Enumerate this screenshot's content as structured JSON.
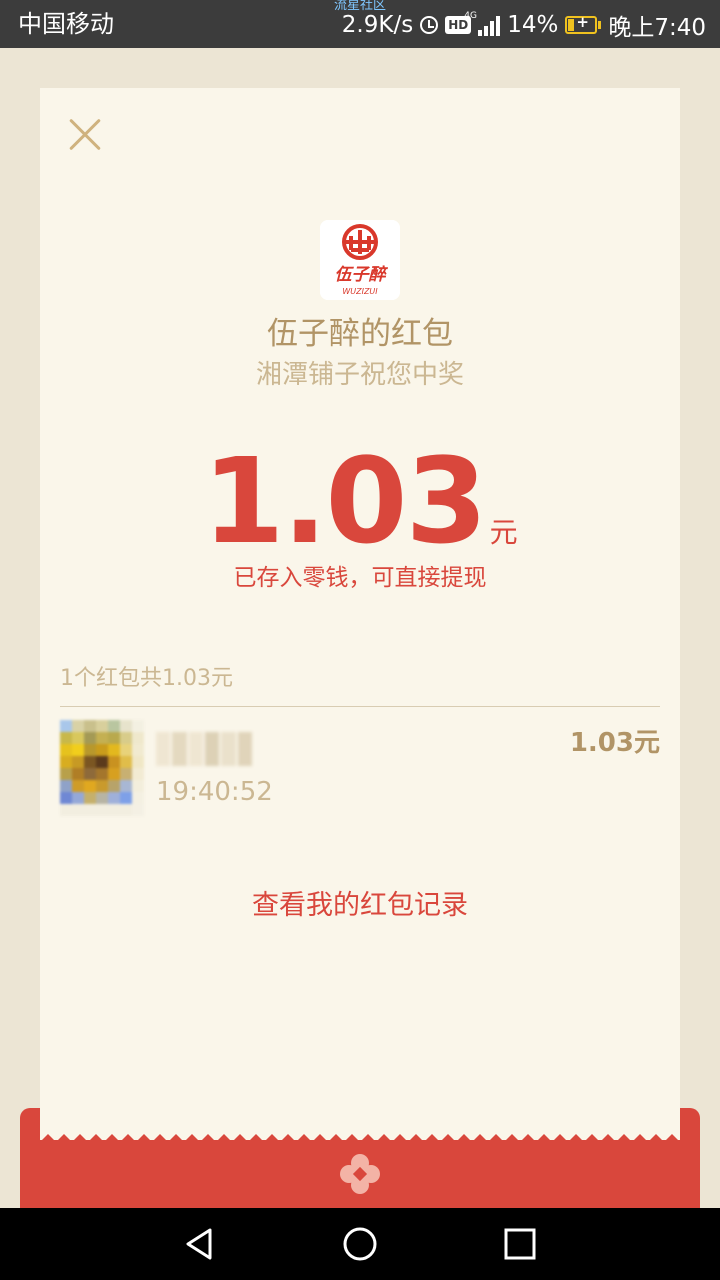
{
  "status_bar": {
    "carrier": "中国移动",
    "overlay_tag": "流星社区",
    "net_speed": "2.9K/s",
    "hd_badge": "HD",
    "network_type": "4G",
    "battery_percent": "14%",
    "time": "晚上7:40",
    "icons": [
      "alarm-icon",
      "signal-icon",
      "battery-icon"
    ],
    "battery_color": "#f0c21f"
  },
  "card": {
    "sender_title": "伍子醉的红包",
    "greeting": "湘潭铺子祝您中奖",
    "amount": "1.03",
    "unit": "元",
    "saved_note": "已存入零钱，可直接提现",
    "summary": "1个红包共1.03元",
    "record": {
      "time": "19:40:52",
      "amount": "1.03元"
    },
    "history_link": "查看我的红包记录",
    "logo": {
      "text": "伍子醉",
      "subtext": "WUZIZUI"
    }
  },
  "colors": {
    "accent_red": "#d9473c",
    "gold": "#b19466",
    "light_gold": "#cbb792",
    "card_bg": "#faf6ea",
    "page_bg": "#ece5d4"
  },
  "nav_bar": {
    "icons": [
      "back-icon",
      "home-icon",
      "recents-icon"
    ]
  }
}
